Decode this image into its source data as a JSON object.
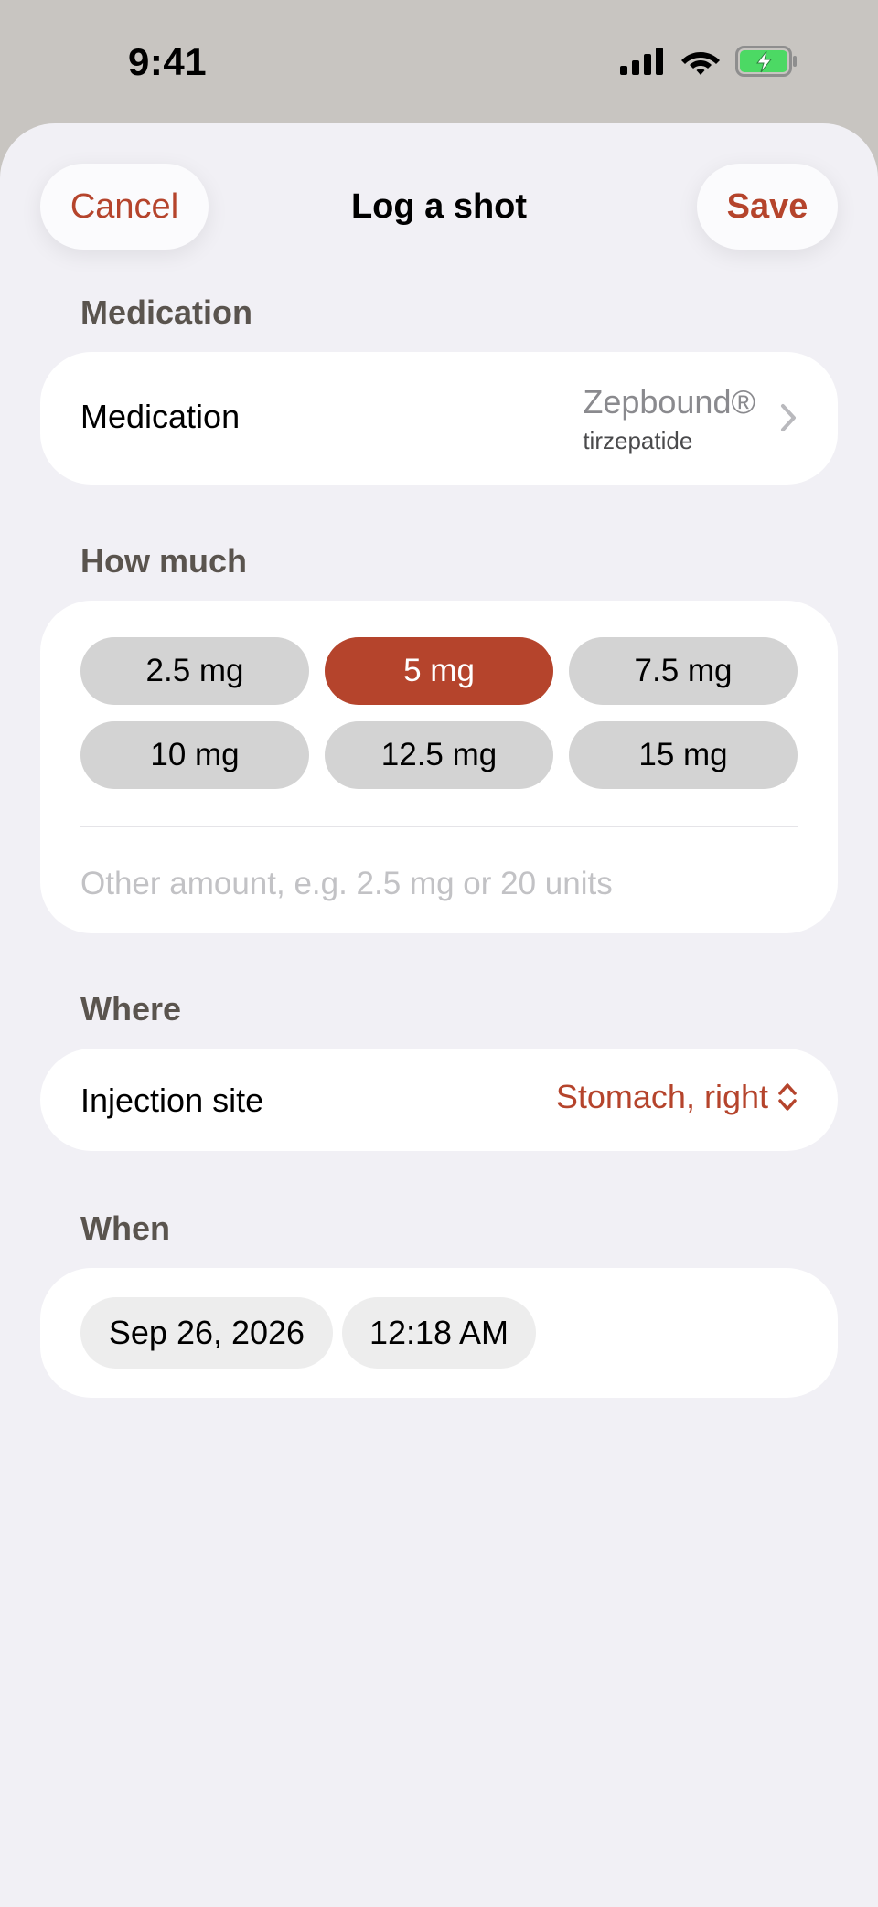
{
  "status_bar": {
    "time": "9:41"
  },
  "nav": {
    "cancel_label": "Cancel",
    "title": "Log a shot",
    "save_label": "Save"
  },
  "medication_section": {
    "heading": "Medication",
    "row_label": "Medication",
    "brand_name": "Zepbound®",
    "generic_name": "tirzepatide"
  },
  "dose_section": {
    "heading": "How much",
    "options": [
      "2.5 mg",
      "5 mg",
      "7.5 mg",
      "10 mg",
      "12.5 mg",
      "15 mg"
    ],
    "selected": "5 mg",
    "other_placeholder": "Other amount, e.g. 2.5 mg or 20 units",
    "other_value": ""
  },
  "site_section": {
    "heading": "Where",
    "row_label": "Injection site",
    "value": "Stomach, right"
  },
  "when_section": {
    "heading": "When",
    "date": "Sep 26, 2026",
    "time": "12:18 AM"
  },
  "colors": {
    "accent": "#b5442c",
    "sheet_background": "#f1f0f5",
    "card_background": "#ffffff",
    "pill_background": "#d3d3d3",
    "battery_fill": "#4cd964"
  },
  "icons": [
    "cellular-signal-icon",
    "wifi-icon",
    "battery-charging-icon",
    "chevron-right-icon",
    "chevron-up-down-icon"
  ]
}
